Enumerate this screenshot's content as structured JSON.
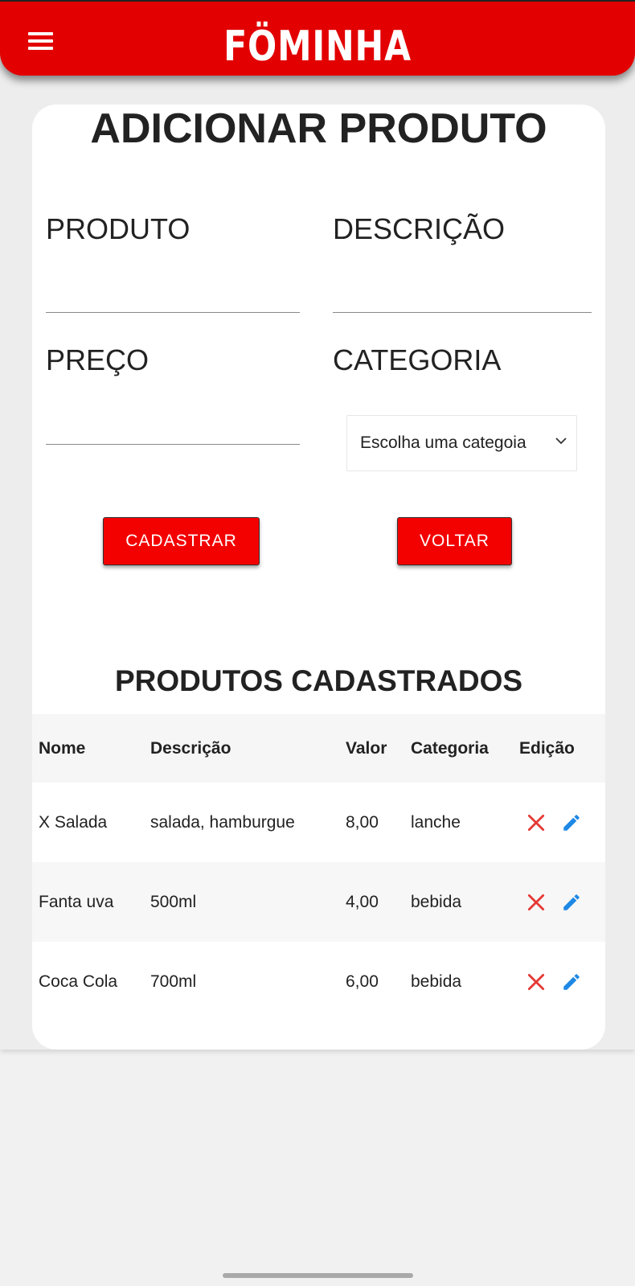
{
  "header": {
    "logo_text": "FÖMINHA",
    "brand_color": "#e20000",
    "menu_icon": "hamburger-menu-icon"
  },
  "form": {
    "title": "ADICIONAR PRODUTO",
    "produto_label": "PRODUTO",
    "produto_value": "",
    "descricao_label": "DESCRIÇÃO",
    "descricao_value": "",
    "preco_label": "PREÇO",
    "preco_value": "",
    "categoria_label": "CATEGORIA",
    "categoria_selected": "Escolha uma categoia",
    "cadastrar_label": "CADASTRAR",
    "voltar_label": "VOLTAR",
    "button_color": "#f30000"
  },
  "products": {
    "title": "PRODUTOS CADASTRADOS",
    "columns": [
      "Nome",
      "Descrição",
      "Valor",
      "Categoria",
      "Edição"
    ],
    "rows": [
      {
        "nome": "X Salada",
        "descricao": "salada, hamburgue",
        "valor": "8,00",
        "categoria": "lanche"
      },
      {
        "nome": "Fanta uva",
        "descricao": "500ml",
        "valor": "4,00",
        "categoria": "bebida"
      },
      {
        "nome": "Coca Cola",
        "descricao": "700ml",
        "valor": "6,00",
        "categoria": "bebida"
      }
    ],
    "delete_icon": "close-icon",
    "edit_icon": "pencil-icon",
    "delete_color": "#e53935",
    "edit_color": "#1e88e5"
  }
}
